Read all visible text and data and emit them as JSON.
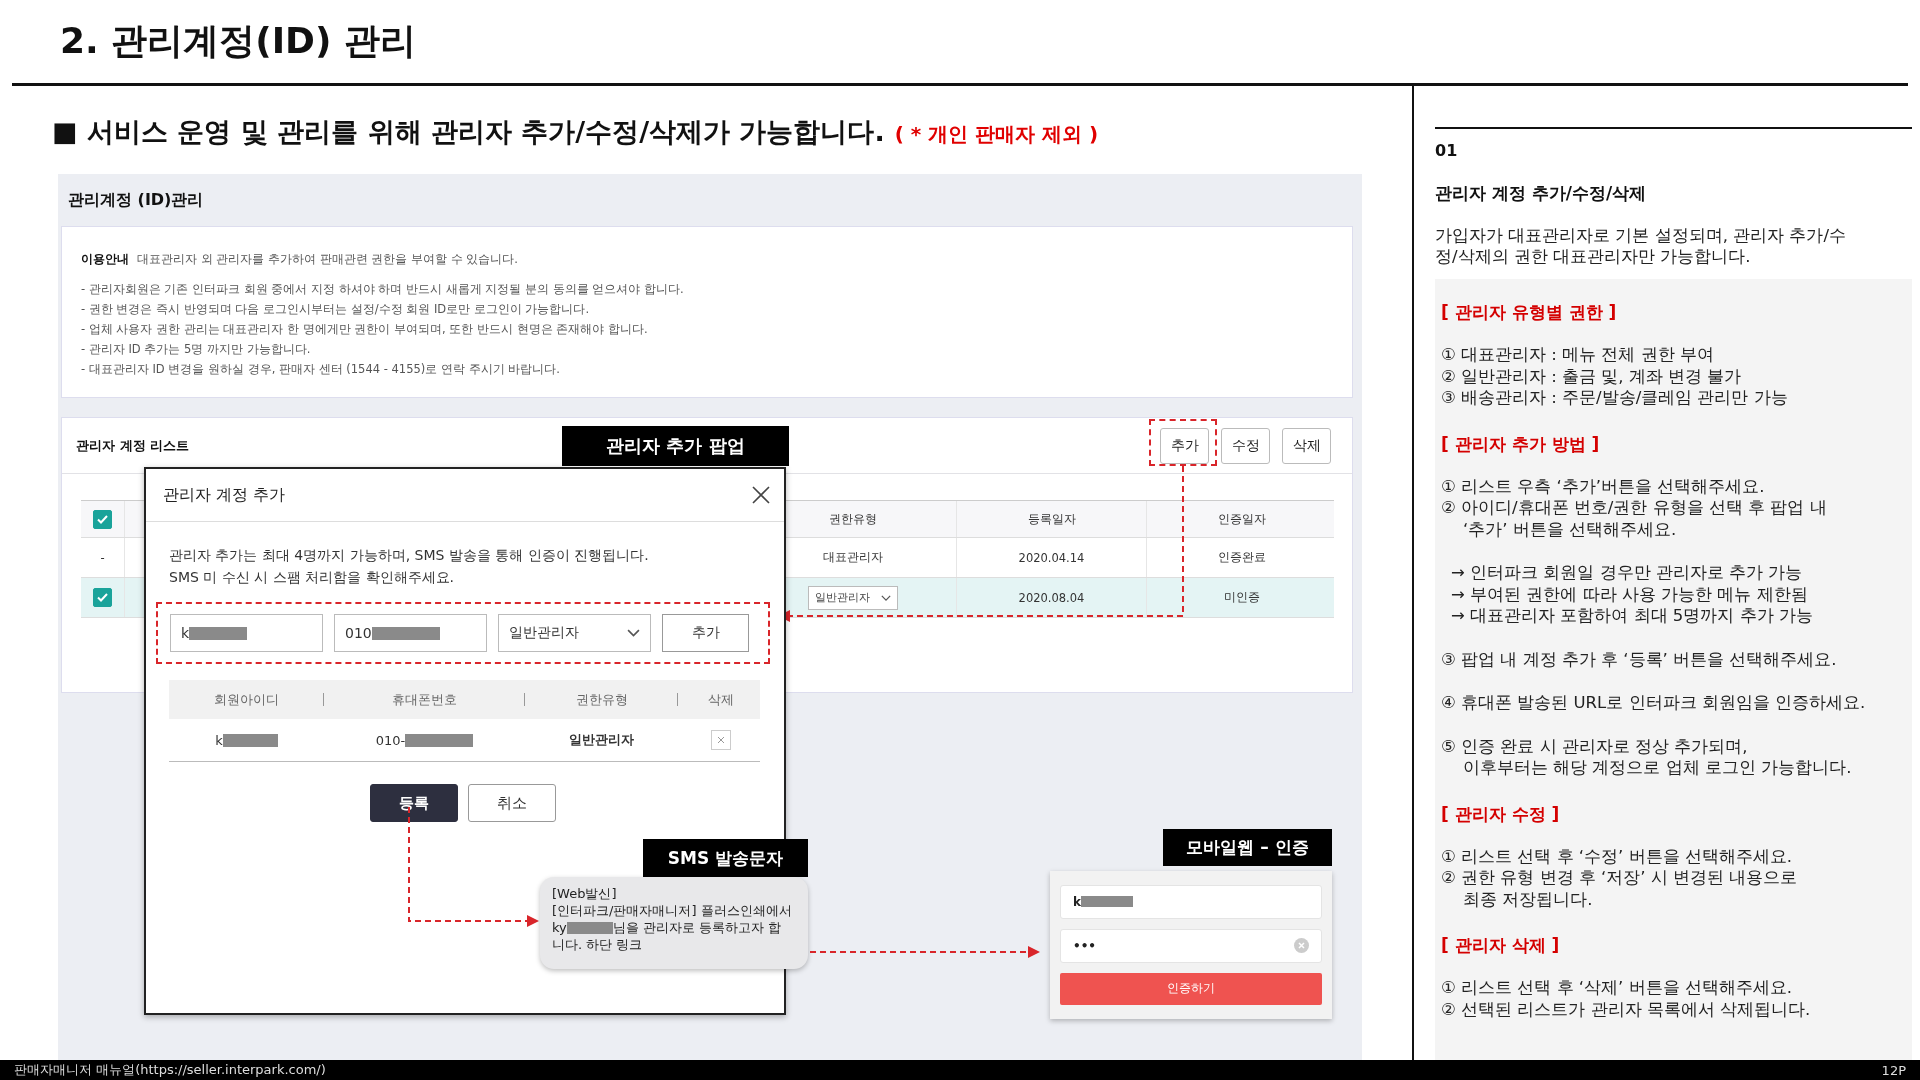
{
  "page_title": "2. 관리계정(ID) 관리",
  "heading": {
    "text": "■ 서비스 운영 및 관리를 위해 관리자 추가/수정/삭제가 가능합니다.",
    "note": "( * 개인 판매자 제외 )"
  },
  "screen": {
    "title": "관리계정 (ID)관리",
    "notice": {
      "label": "이용안내",
      "intro": "대표관리자 외 관리자를 추가하여 판매관련 권한을 부여할 수 있습니다.",
      "lines": [
        "- 관리자회원은 기존 인터파크 회원 중에서 지정 하셔야 하며 반드시 새롭게 지정될 분의 동의를 얻으셔야 합니다.",
        "- 권한 변경은 즉시 반영되며 다음 로그인시부터는 설정/수정 회원 ID로만 로그인이 가능합니다.",
        "- 업체 사용자 권한 관리는 대표관리자 한 명에게만 권한이 부여되며, 또한 반드시 현명은 존재해야 합니다.",
        "- 관리자 ID 추가는 5명 까지만 가능합니다.",
        "- 대표관리자 ID 변경을 원하실 경우, 판매자 센터 (1544 - 4155)로 연락 주시기 바랍니다."
      ]
    },
    "list": {
      "title": "관리자 계정 리스트",
      "buttons": [
        "추가",
        "수정",
        "삭제"
      ],
      "header_checked": true,
      "columns": [
        "권한유형",
        "등록일자",
        "인증일자"
      ],
      "rows": [
        {
          "selected": false,
          "lead": {
            "kind": "dash",
            "text": "-"
          },
          "role": {
            "kind": "text",
            "text": "대표관리자"
          },
          "registered": "2020.04.14",
          "verified": "인증완료"
        },
        {
          "selected": true,
          "lead": {
            "kind": "checkbox",
            "checked": true
          },
          "role": {
            "kind": "select",
            "text": "일반관리자"
          },
          "registered": "2020.08.04",
          "verified": "미인증"
        }
      ]
    },
    "popup": {
      "label": "관리자 추가 팝업",
      "title": "관리자 계정 추가",
      "message": "관리자 추가는 최대 4명까지 가능하며, SMS 발송을 통해 인증이 진행됩니다.\nSMS 미 수신 시 스팸 처리함을 확인해주세요.",
      "id_value": "k",
      "phone_value": "010",
      "role_select": "일반관리자",
      "add_button": "추가",
      "columns": [
        "회원아이디",
        "휴대폰번호",
        "권한유형",
        "삭제"
      ],
      "rows": [
        {
          "id": "k",
          "phone": "010-",
          "role": "일반관리자"
        }
      ],
      "buttons": [
        "등록",
        "취소"
      ]
    },
    "sms": {
      "label": "SMS 발송문자",
      "lines": [
        "[Web발신]",
        "[인터파크/판매자매니저] 플러스인쇄에서"
      ],
      "masked_before": "ky",
      "masked_after": "님을 관리자로 등록하고자 합",
      "last_line": "니다. 하단 링크"
    },
    "mobile": {
      "label": "모바일웹 – 인증",
      "id_value": "k",
      "password": "•••",
      "button": "인증하기"
    }
  },
  "guide": {
    "number": "01",
    "title": "관리자 계정 추가/수정/삭제",
    "description": "가입자가 대표관리자로 기본 설정되며, 관리자 추가/수\n정/삭제의 권한 대표관리자만 가능합니다.",
    "sections": [
      {
        "heading": "[ 관리자 유형별 권한 ]",
        "groups": [
          [
            {
              "kind": "step",
              "text": "① 대표관리자 : 메뉴 전체 권한 부여"
            },
            {
              "kind": "step",
              "text": "② 일반관리자 : 출금 및, 계좌 변경 불가"
            },
            {
              "kind": "step",
              "text": "③ 배송관리자 : 주문/발송/클레임 관리만 가능"
            }
          ]
        ]
      },
      {
        "heading": "[ 관리자 추가 방법 ]",
        "groups": [
          [
            {
              "kind": "step",
              "text": "① 리스트 우측 ‘추가’버튼을 선택해주세요."
            },
            {
              "kind": "step",
              "text": "② 아이디/휴대폰 번호/권한 유형을 선택 후 팝업 내\n‘추가’ 버튼을 선택해주세요."
            }
          ],
          [
            {
              "kind": "arrow",
              "text": "→ 인터파크 회원일 경우만 관리자로 추가 가능"
            },
            {
              "kind": "arrow",
              "text": "→ 부여된 권한에 따라 사용 가능한 메뉴 제한됨"
            },
            {
              "kind": "arrow",
              "text": "→ 대표관리자 포함하여 최대 5명까지 추가 가능"
            }
          ],
          [
            {
              "kind": "step",
              "text": "③ 팝업 내 계정 추가 후 ‘등록’ 버튼을 선택해주세요."
            }
          ],
          [
            {
              "kind": "step",
              "text": "④ 휴대폰 발송된 URL로 인터파크 회원임을 인증하세요."
            }
          ],
          [
            {
              "kind": "step",
              "text": "⑤ 인증 완료 시 관리자로 정상 추가되며,\n이후부터는 해당 계정으로 업체 로그인 가능합니다."
            }
          ]
        ]
      },
      {
        "heading": "[ 관리자 수정 ]",
        "groups": [
          [
            {
              "kind": "step",
              "text": "① 리스트 선택 후 ‘수정’ 버튼을 선택해주세요."
            },
            {
              "kind": "step",
              "text": "② 권한 유형 변경 후 ‘저장’ 시 변경된 내용으로\n최종 저장됩니다."
            }
          ]
        ]
      },
      {
        "heading": "[ 관리자 삭제 ]",
        "groups": [
          [
            {
              "kind": "step",
              "text": "① 리스트 선택 후 ‘삭제’ 버튼을 선택해주세요."
            },
            {
              "kind": "step",
              "text": "② 선택된 리스트가 관리자 목록에서 삭제됩니다."
            }
          ]
        ]
      }
    ]
  },
  "footer": {
    "source": "판매자매니저 매뉴얼(https://seller.interpark.com/)",
    "page": "12P"
  }
}
